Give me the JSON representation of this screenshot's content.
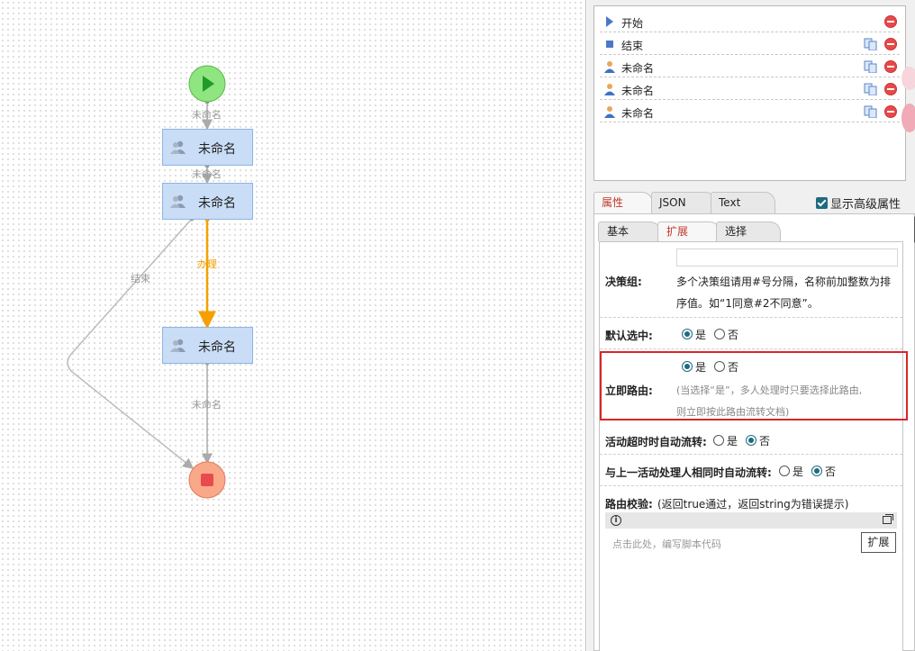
{
  "canvas": {
    "start_edge_label": "未命名",
    "edge12_label": "未命名",
    "edge_end_label": "结束",
    "edge_process_label": "办理",
    "edge3_end_label": "未命名",
    "nodes": [
      {
        "label": "未命名"
      },
      {
        "label": "未命名"
      },
      {
        "label": "未命名"
      }
    ],
    "colors": {
      "active_edge": "#f5a000",
      "node_fill": "#c9ddf7",
      "start_fill": "#8fe57f",
      "end_fill": "#f9a98a"
    }
  },
  "outline": {
    "items": [
      {
        "label": "开始",
        "icon": "play-icon"
      },
      {
        "label": "结束",
        "icon": "stop-icon"
      },
      {
        "label": "未命名",
        "icon": "user-icon"
      },
      {
        "label": "未命名",
        "icon": "user-icon"
      },
      {
        "label": "未命名",
        "icon": "user-icon"
      }
    ]
  },
  "tabs": {
    "main": [
      "属性",
      "JSON",
      "Text"
    ],
    "active": "属性",
    "show_advanced": "显示高级属性",
    "sub": [
      "基本",
      "扩展",
      "选择"
    ],
    "sub_active": "扩展"
  },
  "props": {
    "decision_group": {
      "label": "决策组:",
      "value": "",
      "hint_line1": "多个决策组请用#号分隔，名称前加整数为排",
      "hint_line2": "序值。如“1同意#2不同意”。"
    },
    "default_selected": {
      "label": "默认选中:",
      "yes": "是",
      "no": "否",
      "selected": "是"
    },
    "immediate_route": {
      "label": "立即路由:",
      "yes": "是",
      "no": "否",
      "selected": "是",
      "hint_line1": "(当选择“是”，多人处理时只要选择此路由,",
      "hint_line2": "则立即按此路由流转文档)"
    },
    "auto_timeout": {
      "label": "活动超时时自动流转:",
      "yes": "是",
      "no": "否",
      "selected": "否"
    },
    "auto_same_handler": {
      "label": "与上一活动处理人相同时自动流转:",
      "yes": "是",
      "no": "否",
      "selected": "否"
    },
    "route_check": {
      "label": "路由校验:",
      "hint": "(返回true通过，返回string为错误提示)",
      "placeholder": "点击此处，编写脚本代码",
      "expand_button": "扩展"
    }
  }
}
